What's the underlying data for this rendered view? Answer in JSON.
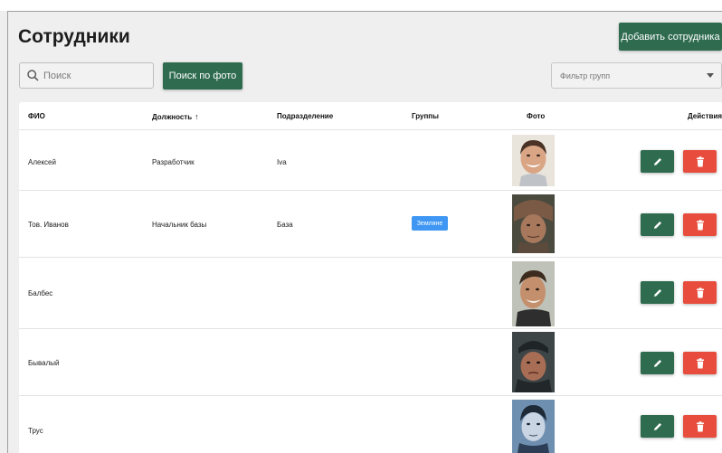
{
  "page": {
    "title": "Сотрудники",
    "add_button": "Добавить сотрудника"
  },
  "toolbar": {
    "search_placeholder": "Поиск",
    "photo_search_button": "Поиск по фото",
    "group_filter_placeholder": "Фильтр групп"
  },
  "table": {
    "columns": {
      "name": "ФИО",
      "position": "Должность",
      "department": "Подразделение",
      "groups": "Группы",
      "photo": "Фото",
      "actions": "Действия"
    },
    "sort": {
      "column": "position",
      "direction": "asc",
      "arrow": "↑"
    },
    "rows": [
      {
        "name": "Алексей",
        "position": "Разработчик",
        "department": "Iva",
        "group": ""
      },
      {
        "name": "Тов. Иванов",
        "position": "Начальник базы",
        "department": "База",
        "group": "Земляне"
      },
      {
        "name": "Балбес",
        "position": "",
        "department": "",
        "group": ""
      },
      {
        "name": "Бывалый",
        "position": "",
        "department": "",
        "group": ""
      },
      {
        "name": "Трус",
        "position": "",
        "department": "",
        "group": ""
      }
    ]
  },
  "colors": {
    "primary": "#2e6b4f",
    "danger": "#e74c3c",
    "badge": "#3f97f3",
    "background": "#efefef"
  },
  "icons": {
    "search": "magnifier-icon",
    "edit": "pencil-icon",
    "delete": "trash-icon",
    "dropdown": "caret-down-icon"
  }
}
